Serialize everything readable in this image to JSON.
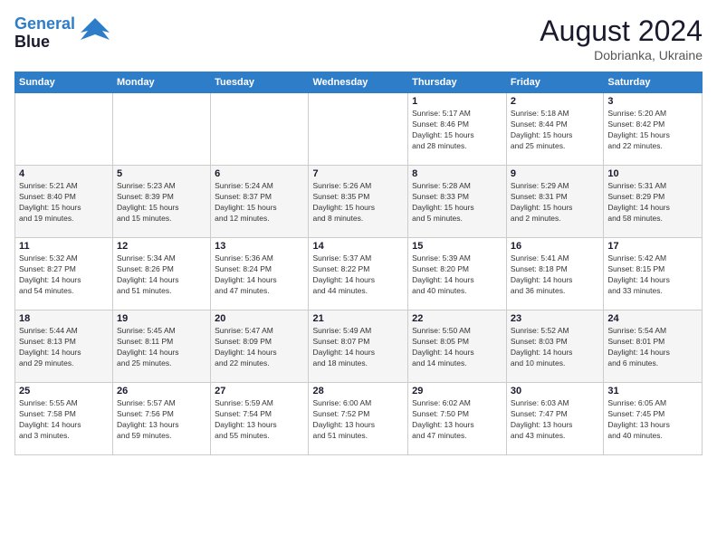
{
  "header": {
    "logo_line1": "General",
    "logo_line2": "Blue",
    "month_year": "August 2024",
    "location": "Dobrianka, Ukraine"
  },
  "days_of_week": [
    "Sunday",
    "Monday",
    "Tuesday",
    "Wednesday",
    "Thursday",
    "Friday",
    "Saturday"
  ],
  "weeks": [
    [
      {
        "day": "",
        "info": ""
      },
      {
        "day": "",
        "info": ""
      },
      {
        "day": "",
        "info": ""
      },
      {
        "day": "",
        "info": ""
      },
      {
        "day": "1",
        "info": "Sunrise: 5:17 AM\nSunset: 8:46 PM\nDaylight: 15 hours\nand 28 minutes."
      },
      {
        "day": "2",
        "info": "Sunrise: 5:18 AM\nSunset: 8:44 PM\nDaylight: 15 hours\nand 25 minutes."
      },
      {
        "day": "3",
        "info": "Sunrise: 5:20 AM\nSunset: 8:42 PM\nDaylight: 15 hours\nand 22 minutes."
      }
    ],
    [
      {
        "day": "4",
        "info": "Sunrise: 5:21 AM\nSunset: 8:40 PM\nDaylight: 15 hours\nand 19 minutes."
      },
      {
        "day": "5",
        "info": "Sunrise: 5:23 AM\nSunset: 8:39 PM\nDaylight: 15 hours\nand 15 minutes."
      },
      {
        "day": "6",
        "info": "Sunrise: 5:24 AM\nSunset: 8:37 PM\nDaylight: 15 hours\nand 12 minutes."
      },
      {
        "day": "7",
        "info": "Sunrise: 5:26 AM\nSunset: 8:35 PM\nDaylight: 15 hours\nand 8 minutes."
      },
      {
        "day": "8",
        "info": "Sunrise: 5:28 AM\nSunset: 8:33 PM\nDaylight: 15 hours\nand 5 minutes."
      },
      {
        "day": "9",
        "info": "Sunrise: 5:29 AM\nSunset: 8:31 PM\nDaylight: 15 hours\nand 2 minutes."
      },
      {
        "day": "10",
        "info": "Sunrise: 5:31 AM\nSunset: 8:29 PM\nDaylight: 14 hours\nand 58 minutes."
      }
    ],
    [
      {
        "day": "11",
        "info": "Sunrise: 5:32 AM\nSunset: 8:27 PM\nDaylight: 14 hours\nand 54 minutes."
      },
      {
        "day": "12",
        "info": "Sunrise: 5:34 AM\nSunset: 8:26 PM\nDaylight: 14 hours\nand 51 minutes."
      },
      {
        "day": "13",
        "info": "Sunrise: 5:36 AM\nSunset: 8:24 PM\nDaylight: 14 hours\nand 47 minutes."
      },
      {
        "day": "14",
        "info": "Sunrise: 5:37 AM\nSunset: 8:22 PM\nDaylight: 14 hours\nand 44 minutes."
      },
      {
        "day": "15",
        "info": "Sunrise: 5:39 AM\nSunset: 8:20 PM\nDaylight: 14 hours\nand 40 minutes."
      },
      {
        "day": "16",
        "info": "Sunrise: 5:41 AM\nSunset: 8:18 PM\nDaylight: 14 hours\nand 36 minutes."
      },
      {
        "day": "17",
        "info": "Sunrise: 5:42 AM\nSunset: 8:15 PM\nDaylight: 14 hours\nand 33 minutes."
      }
    ],
    [
      {
        "day": "18",
        "info": "Sunrise: 5:44 AM\nSunset: 8:13 PM\nDaylight: 14 hours\nand 29 minutes."
      },
      {
        "day": "19",
        "info": "Sunrise: 5:45 AM\nSunset: 8:11 PM\nDaylight: 14 hours\nand 25 minutes."
      },
      {
        "day": "20",
        "info": "Sunrise: 5:47 AM\nSunset: 8:09 PM\nDaylight: 14 hours\nand 22 minutes."
      },
      {
        "day": "21",
        "info": "Sunrise: 5:49 AM\nSunset: 8:07 PM\nDaylight: 14 hours\nand 18 minutes."
      },
      {
        "day": "22",
        "info": "Sunrise: 5:50 AM\nSunset: 8:05 PM\nDaylight: 14 hours\nand 14 minutes."
      },
      {
        "day": "23",
        "info": "Sunrise: 5:52 AM\nSunset: 8:03 PM\nDaylight: 14 hours\nand 10 minutes."
      },
      {
        "day": "24",
        "info": "Sunrise: 5:54 AM\nSunset: 8:01 PM\nDaylight: 14 hours\nand 6 minutes."
      }
    ],
    [
      {
        "day": "25",
        "info": "Sunrise: 5:55 AM\nSunset: 7:58 PM\nDaylight: 14 hours\nand 3 minutes."
      },
      {
        "day": "26",
        "info": "Sunrise: 5:57 AM\nSunset: 7:56 PM\nDaylight: 13 hours\nand 59 minutes."
      },
      {
        "day": "27",
        "info": "Sunrise: 5:59 AM\nSunset: 7:54 PM\nDaylight: 13 hours\nand 55 minutes."
      },
      {
        "day": "28",
        "info": "Sunrise: 6:00 AM\nSunset: 7:52 PM\nDaylight: 13 hours\nand 51 minutes."
      },
      {
        "day": "29",
        "info": "Sunrise: 6:02 AM\nSunset: 7:50 PM\nDaylight: 13 hours\nand 47 minutes."
      },
      {
        "day": "30",
        "info": "Sunrise: 6:03 AM\nSunset: 7:47 PM\nDaylight: 13 hours\nand 43 minutes."
      },
      {
        "day": "31",
        "info": "Sunrise: 6:05 AM\nSunset: 7:45 PM\nDaylight: 13 hours\nand 40 minutes."
      }
    ]
  ]
}
